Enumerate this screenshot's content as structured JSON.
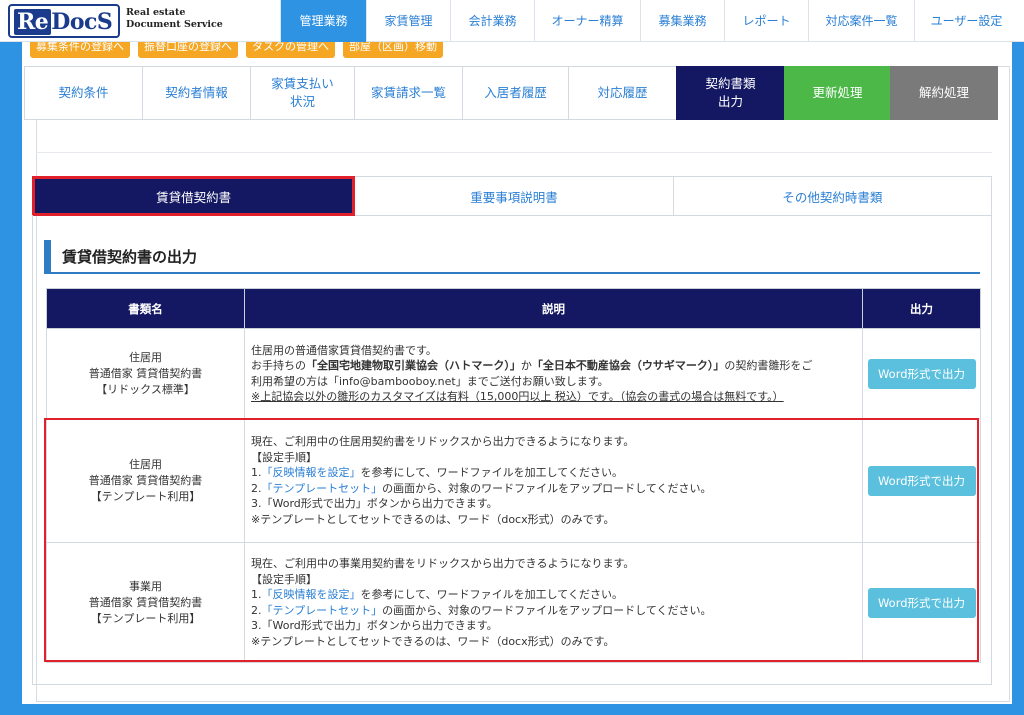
{
  "app": {
    "logo_mark_re": "Re",
    "logo_mark_rest": "DocS",
    "logo_tag_line1": "Real estate",
    "logo_tag_line2": "Document Service"
  },
  "topnav": [
    {
      "label": "管理業務",
      "active": true
    },
    {
      "label": "家賃管理"
    },
    {
      "label": "会計業務"
    },
    {
      "label": "オーナー精算"
    },
    {
      "label": "募集業務"
    },
    {
      "label": "レポート"
    },
    {
      "label": "対応案件一覧"
    },
    {
      "label": "ユーザー設定"
    }
  ],
  "orange_buttons": [
    "募集条件の登録へ",
    "振替口座の登録へ",
    "タスクの管理へ",
    "部屋（区画）移動"
  ],
  "subtabs": [
    {
      "label": "契約条件"
    },
    {
      "label": "契約者情報"
    },
    {
      "label": "家賃支払い状況"
    },
    {
      "label": "家賃請求一覧"
    },
    {
      "label": "入居者履歴"
    },
    {
      "label": "対応履歴"
    },
    {
      "label": "契約書類出力",
      "active": true
    },
    {
      "label": "更新処理"
    },
    {
      "label": "解約処理"
    }
  ],
  "doctabs": [
    {
      "label": "賃貸借契約書",
      "active": true
    },
    {
      "label": "重要事項説明書"
    },
    {
      "label": "その他契約時書類"
    }
  ],
  "section_title": "賃貸借契約書の出力",
  "table": {
    "headers": [
      "書類名",
      "説明",
      "出力"
    ],
    "rows": [
      {
        "name_lines": [
          "住居用",
          "普通借家 賃貸借契約書",
          "【リドックス標準】"
        ],
        "desc": {
          "l1": "住居用の普通借家賃貸借契約書です。",
          "l2a": "お手持ちの",
          "l2b": "「全国宅地建物取引業協会（ハトマーク）」",
          "l2c": "か",
          "l2d": "「全日本不動産協会（ウサギマーク）」",
          "l2e": "の契約書雛形をご",
          "l3": "利用希望の方は「info@bambooboy.net」までご送付お願い致します。",
          "l4": "※上記協会以外の雛形のカスタマイズは有料（15,000円以上 税込）です。（協会の書式の場合は無料です。）"
        },
        "button": "Word形式で出力"
      },
      {
        "name_lines": [
          "住居用",
          "普通借家 賃貸借契約書",
          "【テンプレート利用】"
        ],
        "desc": {
          "l1": "現在、ご利用中の住居用契約書をリドックスから出力できるようになります。",
          "l2": "【設定手順】",
          "l3a": "1.",
          "l3b": "「反映情報を設定」",
          "l3c": "を参考にして、ワードファイルを加工してください。",
          "l4a": "2.",
          "l4b": "「テンプレートセット」",
          "l4c": "の画面から、対象のワードファイルをアップロードしてください。",
          "l5": "3.「Word形式で出力」ボタンから出力できます。",
          "l6": "※テンプレートとしてセットできるのは、ワード（docx形式）のみです。"
        },
        "button": "Word形式で出力"
      },
      {
        "name_lines": [
          "事業用",
          "普通借家 賃貸借契約書",
          "【テンプレート利用】"
        ],
        "desc": {
          "l1": "現在、ご利用中の事業用契約書をリドックスから出力できるようになります。",
          "l2": "【設定手順】",
          "l3a": "1.",
          "l3b": "「反映情報を設定」",
          "l3c": "を参考にして、ワードファイルを加工してください。",
          "l4a": "2.",
          "l4b": "「テンプレートセット」",
          "l4c": "の画面から、対象のワードファイルをアップロードしてください。",
          "l5": "3.「Word形式で出力」ボタンから出力できます。",
          "l6": "※テンプレートとしてセットできるのは、ワード（docx形式）のみです。"
        },
        "button": "Word形式で出力"
      }
    ]
  },
  "colors": {
    "brand_blue": "#2f93e4",
    "navy": "#141863",
    "highlight_red": "#e0202a",
    "button_cyan": "#5bc0de",
    "green": "#4cb848"
  }
}
